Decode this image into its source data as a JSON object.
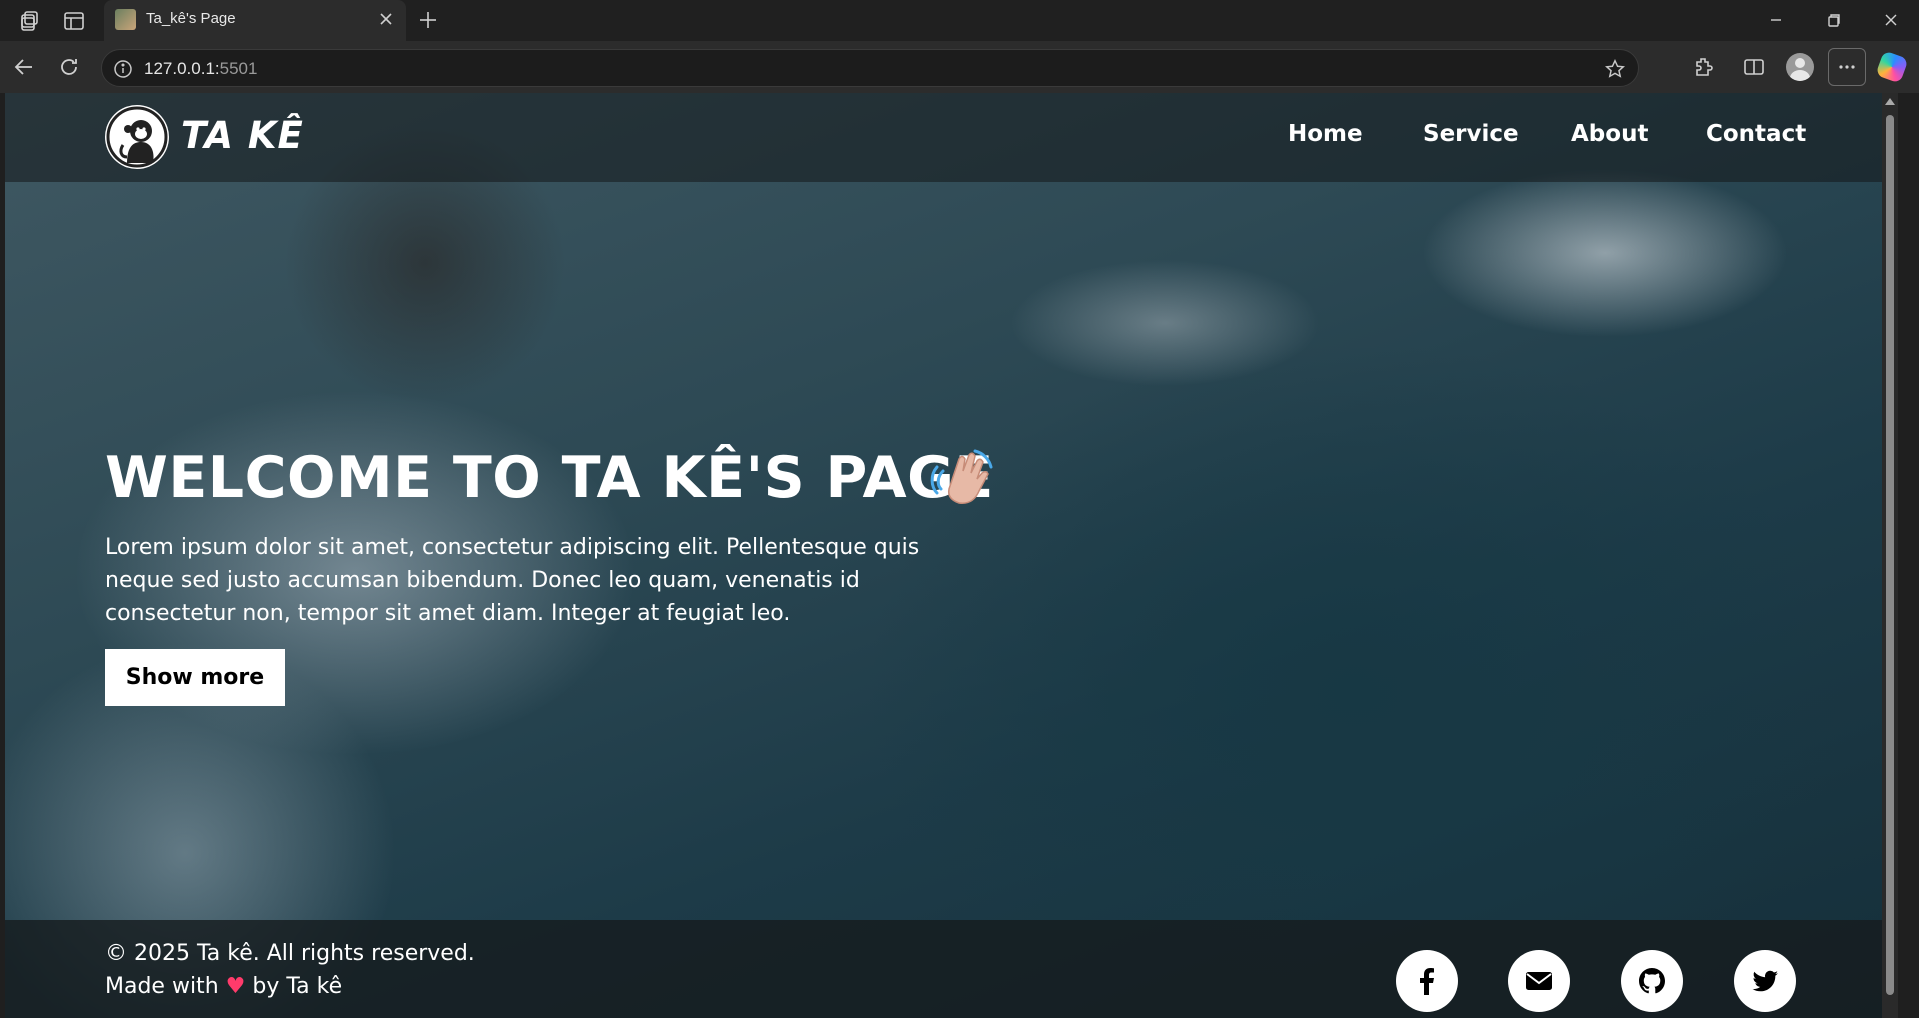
{
  "browser": {
    "tab_title": "Ta_kê's Page",
    "url_host": "127.0.0.1:",
    "url_port": "5501"
  },
  "site": {
    "logo_text": "TA KÊ",
    "nav": [
      "Home",
      "Service",
      "About",
      "Contact"
    ],
    "hero_title": "WELCOME TO TA KÊ'S PAGE",
    "hero_text": "Lorem ipsum dolor sit amet, consectetur adipiscing elit. Pellentesque quis neque sed justo accumsan bibendum. Donec leo quam, venenatis id consectetur non, tempor sit amet diam. Integer at feugiat leo.",
    "cta_label": "Show more",
    "footer_copyright": "© 2025 Ta kê. All rights reserved.",
    "footer_made_prefix": "Made with",
    "footer_heart": "♥",
    "footer_made_suffix": "by Ta kê",
    "social_icons": [
      "facebook-icon",
      "mail-icon",
      "github-icon",
      "twitter-icon"
    ]
  },
  "colors": {
    "chrome_bg": "#202020",
    "header_overlay": "#14181a",
    "button_bg": "#ffffff",
    "heart": "#ff3b6b"
  }
}
